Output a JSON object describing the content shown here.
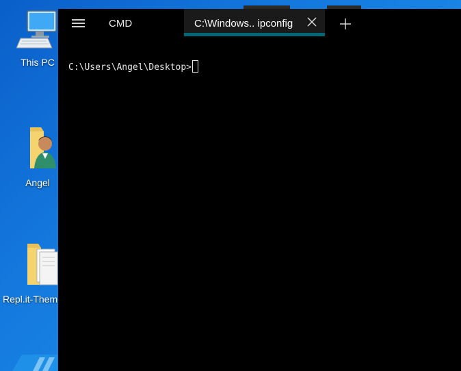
{
  "desktop": {
    "icons": [
      {
        "label": "This PC",
        "icon": "computer-icon"
      },
      {
        "label": "Angel",
        "icon": "user-folder-icon"
      },
      {
        "label": "Repl.it-Them",
        "icon": "folder-icon"
      }
    ]
  },
  "terminal": {
    "tabs": [
      {
        "label": "CMD",
        "active": false
      },
      {
        "label": "C:\\Windows.. ipconfig",
        "active": true
      }
    ],
    "prompt": "C:\\Users\\Angel\\Desktop>",
    "colors": {
      "accent": "#006875",
      "background": "#000000",
      "active_tab": "#1a1a1a"
    }
  }
}
